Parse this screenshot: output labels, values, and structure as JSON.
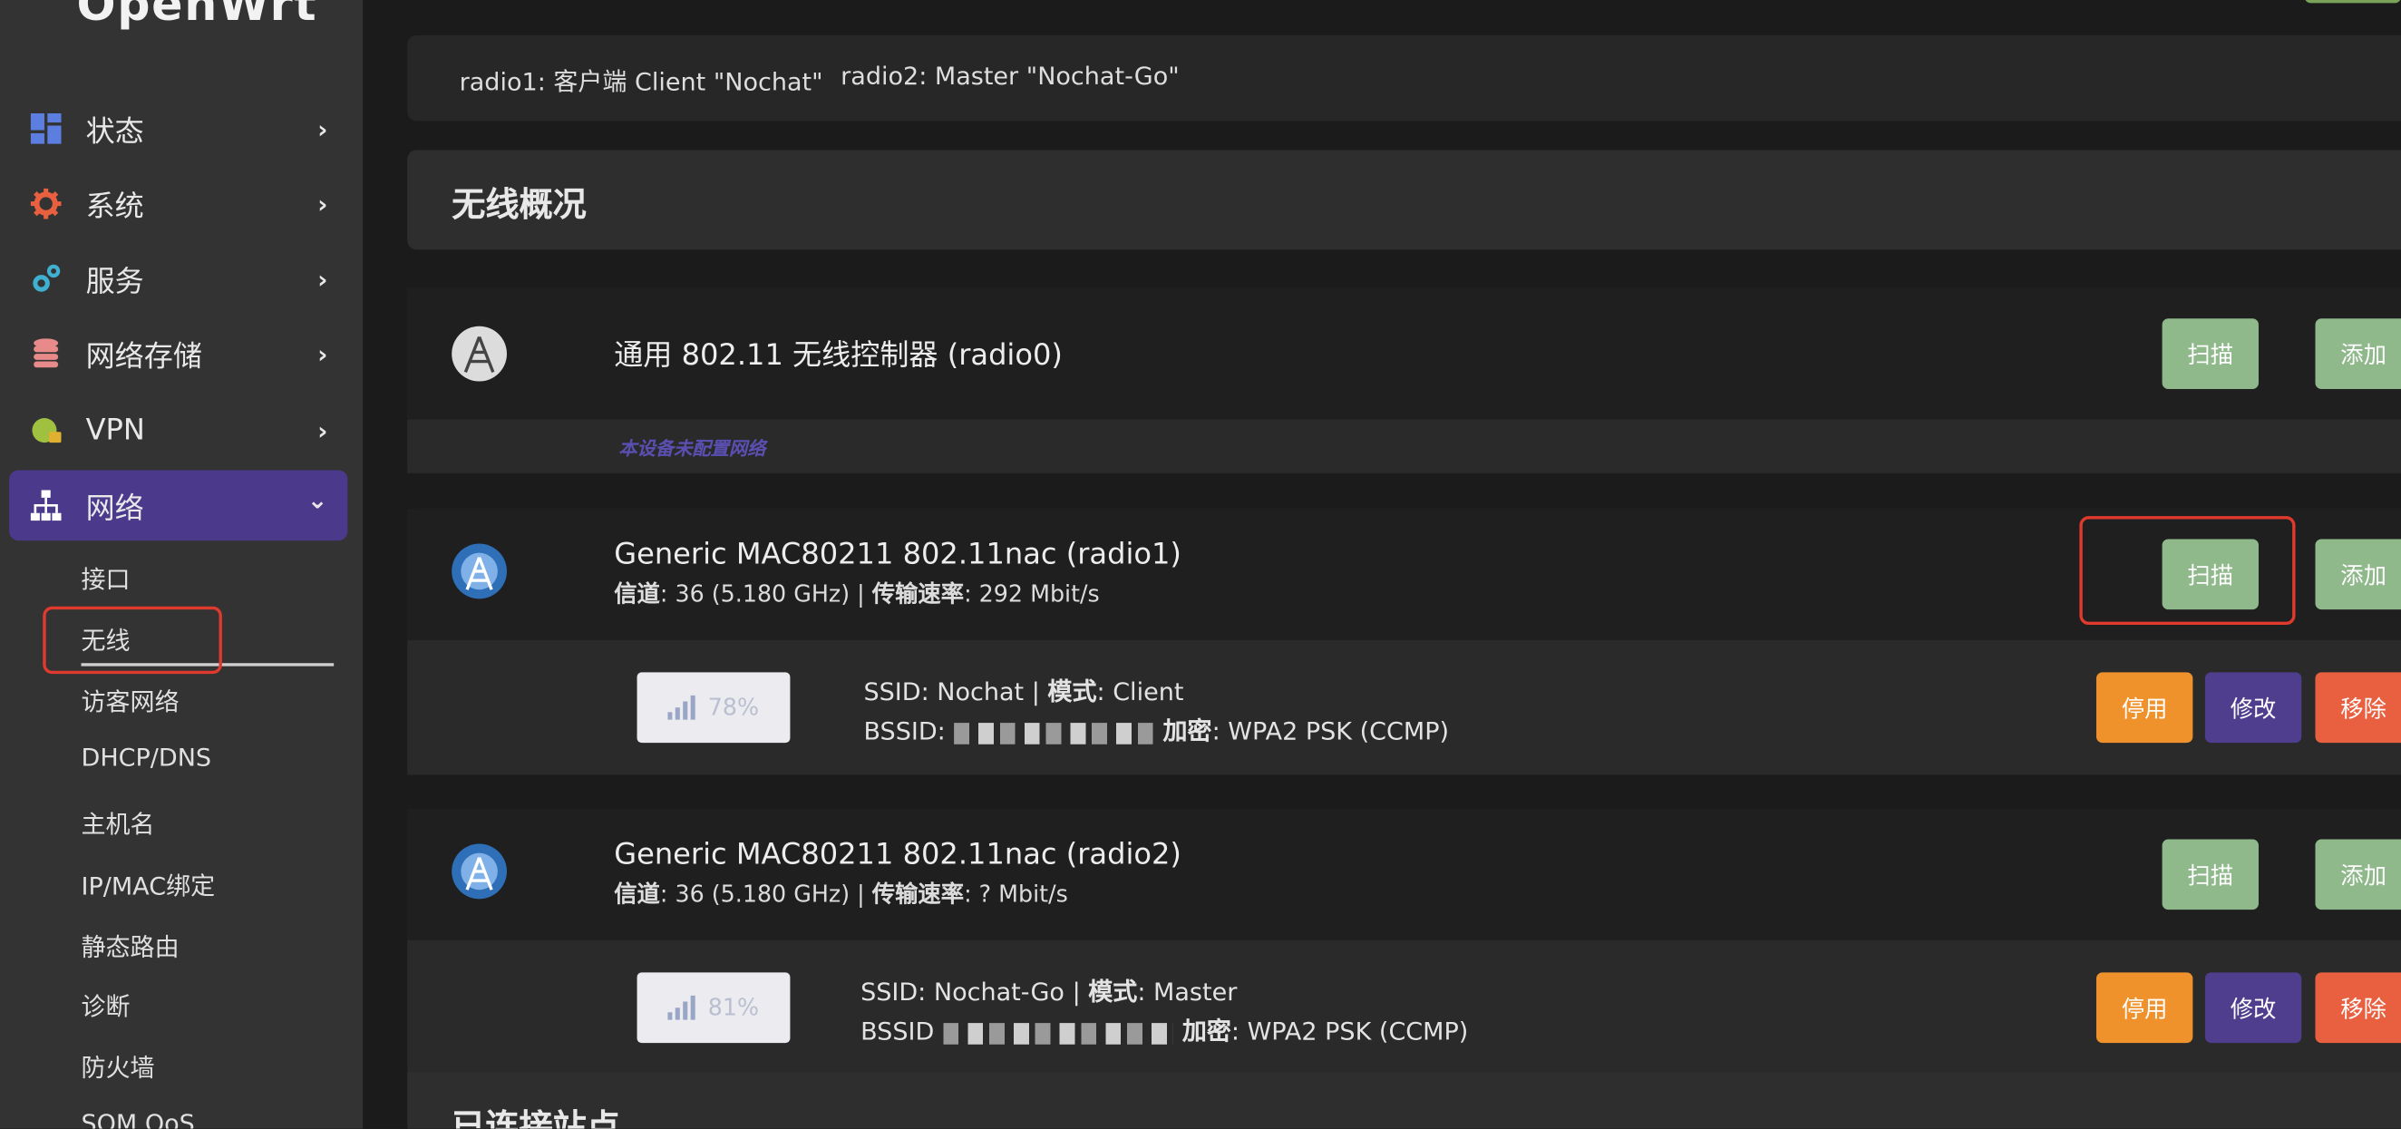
{
  "app": {
    "logo": "OpenWrt"
  },
  "sidebar": {
    "menu": [
      {
        "label": "状态",
        "icon": "dashboard-icon",
        "color": "#5b7ee0"
      },
      {
        "label": "系统",
        "icon": "gear-icon",
        "color": "#e8603f"
      },
      {
        "label": "服务",
        "icon": "cogs-icon",
        "color": "#3fb0d0"
      },
      {
        "label": "网络存储",
        "icon": "database-icon",
        "color": "#e88a8a"
      },
      {
        "label": "VPN",
        "icon": "globe-lock-icon",
        "color": "#a0c040"
      },
      {
        "label": "网络",
        "icon": "network-icon",
        "color": "#ffffff",
        "active": true
      }
    ],
    "chevron_right": "›",
    "chevron_down": "⌄",
    "submenu": [
      "接口",
      "无线",
      "访客网络",
      "DHCP/DNS",
      "主机名",
      "IP/MAC绑定",
      "静态路由",
      "诊断",
      "防火墙",
      "SQM QoS"
    ]
  },
  "main": {
    "radio_tabs": [
      "radio1: 客户端 Client \"Nochat\"",
      "radio2: Master \"Nochat-Go\""
    ],
    "overview_title": "无线概况",
    "next_section_title": "已连接站点",
    "devices": [
      {
        "title": "通用 802.11 无线控制器 (radio0)",
        "channel_label": "",
        "channel_value": "",
        "rate_label": "",
        "rate_value": "",
        "no_network": "本设备未配置网络",
        "scan_label": "扫描",
        "add_label": "添加"
      },
      {
        "title": "Generic MAC80211 802.11nac (radio1)",
        "channel_label": "信道",
        "channel_value": ": 36 (5.180 GHz) | ",
        "rate_label": "传输速率",
        "rate_value": ": 292 Mbit/s",
        "scan_label": "扫描",
        "add_label": "添加",
        "network": {
          "signal": "78%",
          "signal_level": 0.78,
          "ssid_prefix": "SSID: ",
          "ssid": "Nochat",
          "mode_label": "模式",
          "mode": ": Client",
          "bssid_label": "BSSID:",
          "enc_label": "加密",
          "enc": ": WPA2 PSK (CCMP)",
          "disable_label": "停用",
          "edit_label": "修改",
          "remove_label": "移除"
        }
      },
      {
        "title": "Generic MAC80211 802.11nac (radio2)",
        "channel_label": "信道",
        "channel_value": ": 36 (5.180 GHz) | ",
        "rate_label": "传输速率",
        "rate_value": ": ? Mbit/s",
        "scan_label": "扫描",
        "add_label": "添加",
        "network": {
          "signal": "81%",
          "signal_level": 0.81,
          "ssid_prefix": "SSID: ",
          "ssid": "Nochat-Go",
          "mode_label": "模式",
          "mode": ": Master",
          "bssid_label": "BSSID",
          "enc_label": "加密",
          "enc": ": WPA2 PSK (CCMP)",
          "disable_label": "停用",
          "edit_label": "修改",
          "remove_label": "移除"
        }
      }
    ]
  },
  "colors": {
    "accent": "#4b3a8c",
    "highlight": "#e03a2e",
    "scan": "#8fb88b",
    "disable": "#f0922c",
    "edit": "#4f3d8e",
    "remove": "#e8603f"
  }
}
